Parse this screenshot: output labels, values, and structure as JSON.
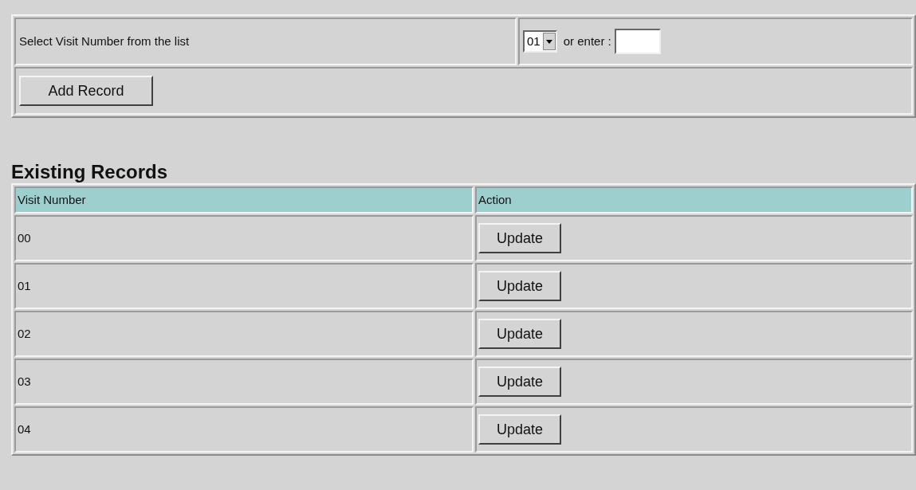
{
  "form": {
    "prompt": "Select Visit Number from the list",
    "select": {
      "value": "01"
    },
    "or_label": "or enter :",
    "add_button": "Add Record"
  },
  "records": {
    "heading": "Existing Records",
    "columns": [
      "Visit Number",
      "Action"
    ],
    "rows": [
      {
        "visit": "00",
        "action": "Update"
      },
      {
        "visit": "01",
        "action": "Update"
      },
      {
        "visit": "02",
        "action": "Update"
      },
      {
        "visit": "03",
        "action": "Update"
      },
      {
        "visit": "04",
        "action": "Update"
      }
    ]
  }
}
